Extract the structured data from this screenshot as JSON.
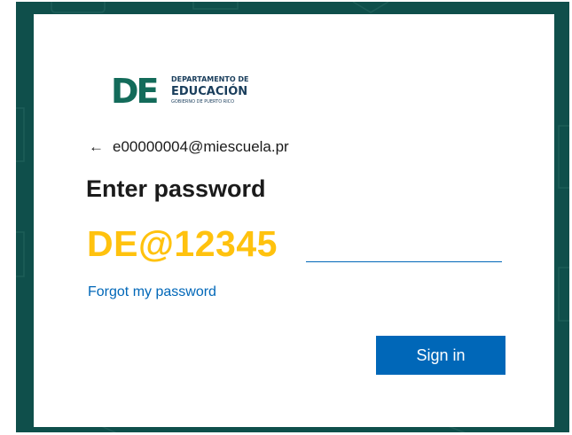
{
  "colors": {
    "background": "#0f4f4b",
    "card": "#ffffff",
    "accent_blue": "#0067b8",
    "overlay_yellow": "#ffc20e",
    "logo_green": "#136b5a"
  },
  "logo": {
    "mark": "DE",
    "line1": "DEPARTAMENTO DE",
    "line2": "EDUCACIÓN",
    "line3": "GOBIERNO DE PUERTO RICO"
  },
  "identity": {
    "back_icon": "arrow-left-icon",
    "email": "e00000004@miescuela.pr"
  },
  "form": {
    "title": "Enter password",
    "password_hint": "DE@12345",
    "password_value": "",
    "forgot_label": "Forgot my password",
    "signin_label": "Sign in"
  }
}
